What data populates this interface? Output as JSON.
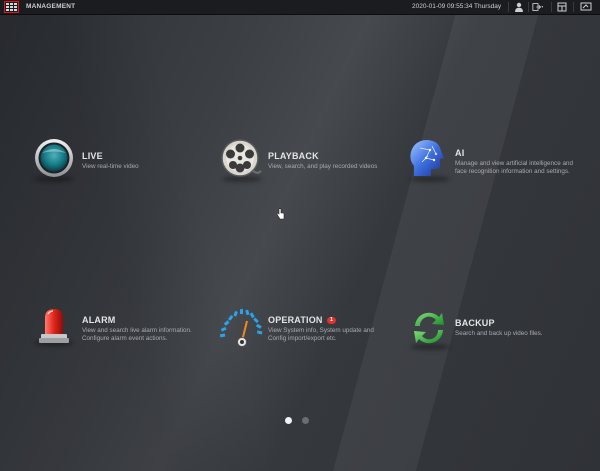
{
  "header": {
    "title": "MANAGEMENT",
    "datetime": "2020-01-09 09:55:34 Thursday",
    "icons": [
      "menu-grid-icon",
      "user-icon",
      "logout-icon",
      "layout-icon",
      "display-icon"
    ]
  },
  "tiles": [
    {
      "id": "live",
      "title": "LIVE",
      "desc": "View real-time video",
      "icon": "live-camera-icon"
    },
    {
      "id": "playback",
      "title": "PLAYBACK",
      "desc": "View, search, and play recorded videos",
      "icon": "film-reel-icon"
    },
    {
      "id": "ai",
      "title": "AI",
      "desc": "Manage and view artificial intelligence and face recognition information and settings.",
      "icon": "ai-head-icon"
    },
    {
      "id": "alarm",
      "title": "ALARM",
      "desc": "View and search live alarm information. Configure alarm event actions.",
      "icon": "alarm-light-icon"
    },
    {
      "id": "operation",
      "title": "OPERATION",
      "badge": "1",
      "desc": "View System info, System update and Config import/export etc.",
      "icon": "gauge-icon"
    },
    {
      "id": "backup",
      "title": "BACKUP",
      "desc": "Search and back up video files.",
      "icon": "sync-arrows-icon"
    }
  ],
  "pagination": {
    "pages": 2,
    "current": 1
  },
  "colors": {
    "accent_red": "#e01818",
    "badge_red": "#e0312b",
    "backup_green": "#2fae3a"
  }
}
